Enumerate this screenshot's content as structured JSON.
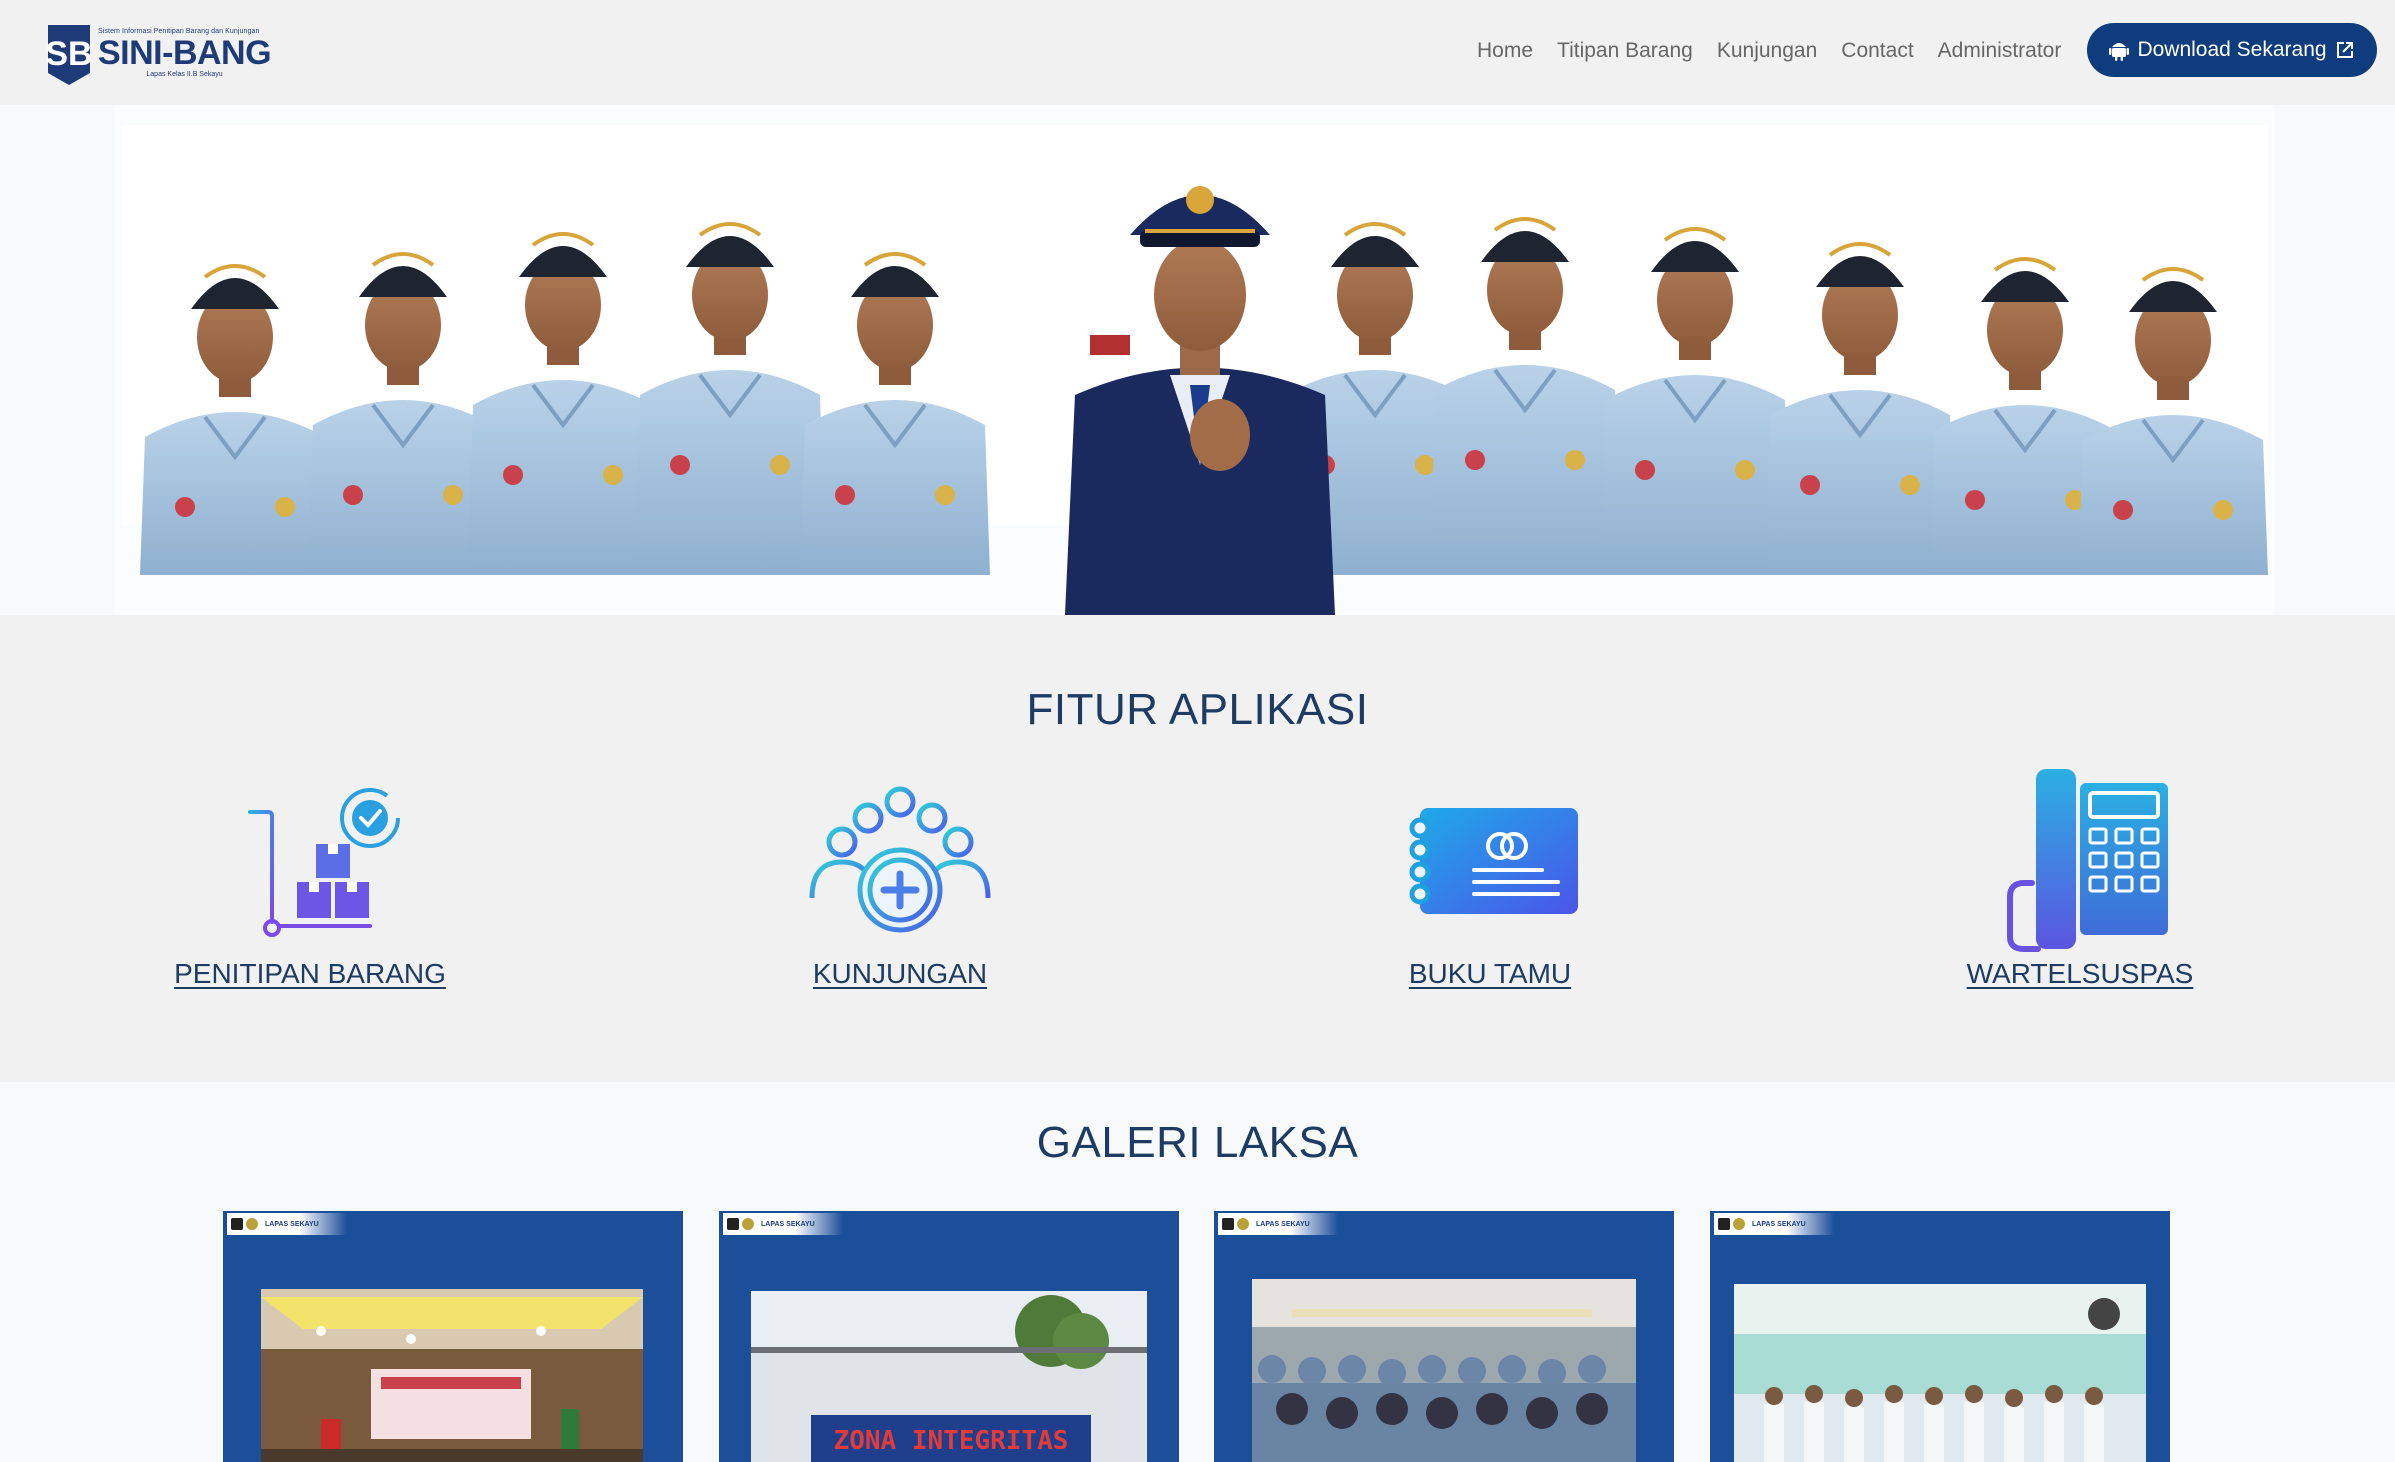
{
  "brand": {
    "tagline": "Sistem Informasi Penitipan Barang dan Kunjungan",
    "name": "SINI-BANG",
    "subtitle": "Lapas Kelas II.B Sekayu"
  },
  "nav": {
    "items": [
      {
        "label": "Home"
      },
      {
        "label": "Titipan Barang"
      },
      {
        "label": "Kunjungan"
      },
      {
        "label": "Contact"
      },
      {
        "label": "Administrator"
      }
    ],
    "download_label": "Download Sekarang"
  },
  "fitur": {
    "title": "FITUR APLIKASI",
    "items": [
      {
        "label": "PENITIPAN BARANG",
        "icon": "package-trolley-icon"
      },
      {
        "label": "KUNJUNGAN",
        "icon": "people-plus-icon"
      },
      {
        "label": "BUKU TAMU",
        "icon": "guestbook-icon"
      },
      {
        "label": "WARTELSUSPAS",
        "icon": "telephone-icon"
      }
    ]
  },
  "galeri": {
    "title": "GALERI LAKSA",
    "watermark": "LAPAS SEKAYU",
    "items": [
      {
        "photo": "hall-meeting-photo"
      },
      {
        "photo": "zona-integritas-photo",
        "sign_text": "ZONA INTEGRITAS"
      },
      {
        "photo": "audience-seated-photo"
      },
      {
        "photo": "group-standing-photo"
      }
    ]
  },
  "colors": {
    "primary": "#0f3c7c",
    "heading": "#1d3b63",
    "uniform": "#a9c6e0",
    "gallery_bg": "#1c4f9a"
  }
}
